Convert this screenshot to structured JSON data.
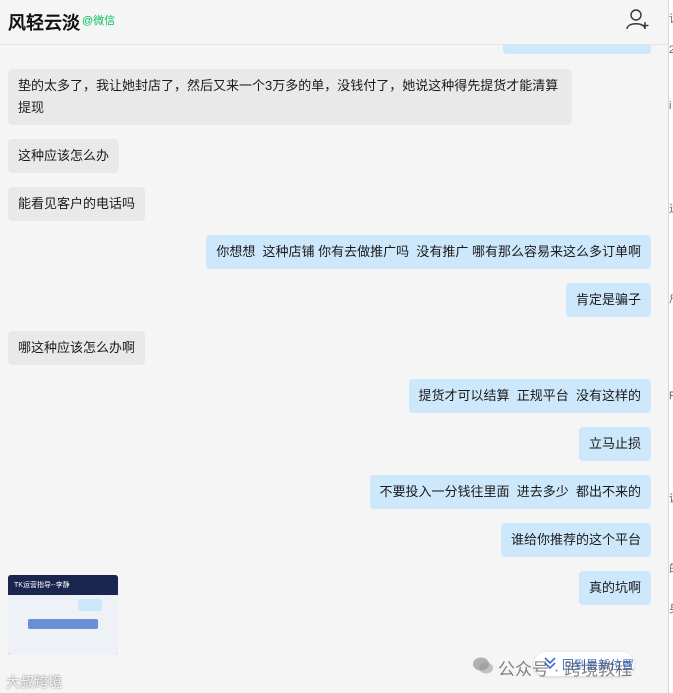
{
  "header": {
    "title": "风轻云淡",
    "tag": "@微信"
  },
  "messages": [
    {
      "side": "left",
      "text": "垫的太多了，我让她封店了，然后又来一个3万多的单，没钱付了，她说这种得先提货才能清算\n提现"
    },
    {
      "side": "left",
      "text": "这种应该怎么办"
    },
    {
      "side": "left",
      "text": "能看见客户的电话吗"
    },
    {
      "side": "right",
      "text": "你想想  这种店铺 你有去做推广吗  没有推广 哪有那么容易来这么多订单啊"
    },
    {
      "side": "right",
      "text": "肯定是骗子"
    },
    {
      "side": "left",
      "text": "哪这种应该怎么办啊"
    },
    {
      "side": "right",
      "text": "提货才可以结算  正规平台  没有这样的"
    },
    {
      "side": "right",
      "text": "立马止损"
    },
    {
      "side": "right",
      "text": "不要投入一分钱往里面  进去多少  都出不来的"
    },
    {
      "side": "right",
      "text": "谁给你推荐的这个平台"
    },
    {
      "side": "right",
      "text": "真的坑啊"
    }
  ],
  "thumbnail": {
    "title": "TK运营指导--李静"
  },
  "bottom": {
    "back_label": "回到最新位置",
    "watermark_left": "大叔跨境",
    "watermark_right": "公众号 · 跨境教程"
  },
  "edge_chars": [
    "谈",
    "2",
    "i",
    "运",
    "户",
    "F",
    "说",
    "的",
    "身"
  ],
  "colors": {
    "bubble_self": "#cde7fb",
    "bubble_other": "#e9e9e9",
    "accent_green": "#07c160",
    "link_blue": "#3a6fd8"
  }
}
